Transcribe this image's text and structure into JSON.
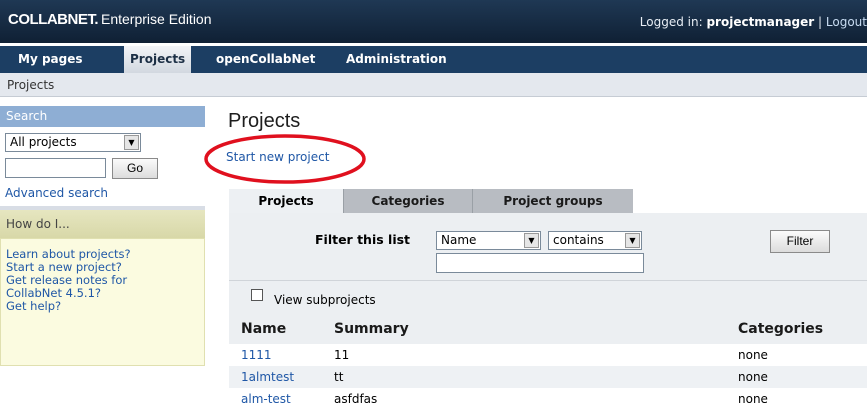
{
  "header": {
    "logo_main": "COLLABNET.",
    "logo_sub": "Enterprise Edition",
    "logged_in_label": "Logged in:",
    "user": "projectmanager",
    "separator": "|",
    "logout": "Logout"
  },
  "nav": {
    "items": [
      {
        "label": "My pages"
      },
      {
        "label": "Projects"
      },
      {
        "label": "openCollabNet"
      },
      {
        "label": "Administration"
      }
    ]
  },
  "breadcrumb": "Projects",
  "sidebar": {
    "search": {
      "title": "Search",
      "scope_selected": "All projects",
      "go_label": "Go",
      "advanced": "Advanced search"
    },
    "howdo": {
      "title": "How do I...",
      "links": [
        "Learn about projects?",
        "Start a new project?",
        "Get release notes for",
        "CollabNet 4.5.1?",
        "Get help?"
      ]
    }
  },
  "main": {
    "title": "Projects",
    "start_new": "Start new project",
    "tabs": [
      "Projects",
      "Categories",
      "Project groups"
    ],
    "filter": {
      "label": "Filter this list",
      "field_selected": "Name",
      "operator_selected": "contains",
      "button": "Filter"
    },
    "view_subprojects": "View subprojects",
    "table": {
      "columns": [
        "Name",
        "Summary",
        "Categories"
      ],
      "rows": [
        {
          "name": "1111",
          "summary": "11",
          "categories": "none"
        },
        {
          "name": "1almtest",
          "summary": "tt",
          "categories": "none"
        },
        {
          "name": "alm-test",
          "summary": "asfdfas",
          "categories": "none"
        }
      ]
    }
  },
  "colors": {
    "header_bg": "#1f3854",
    "nav_bg": "#1c3e63",
    "link": "#1f57a6",
    "annotation": "#e0101e"
  }
}
